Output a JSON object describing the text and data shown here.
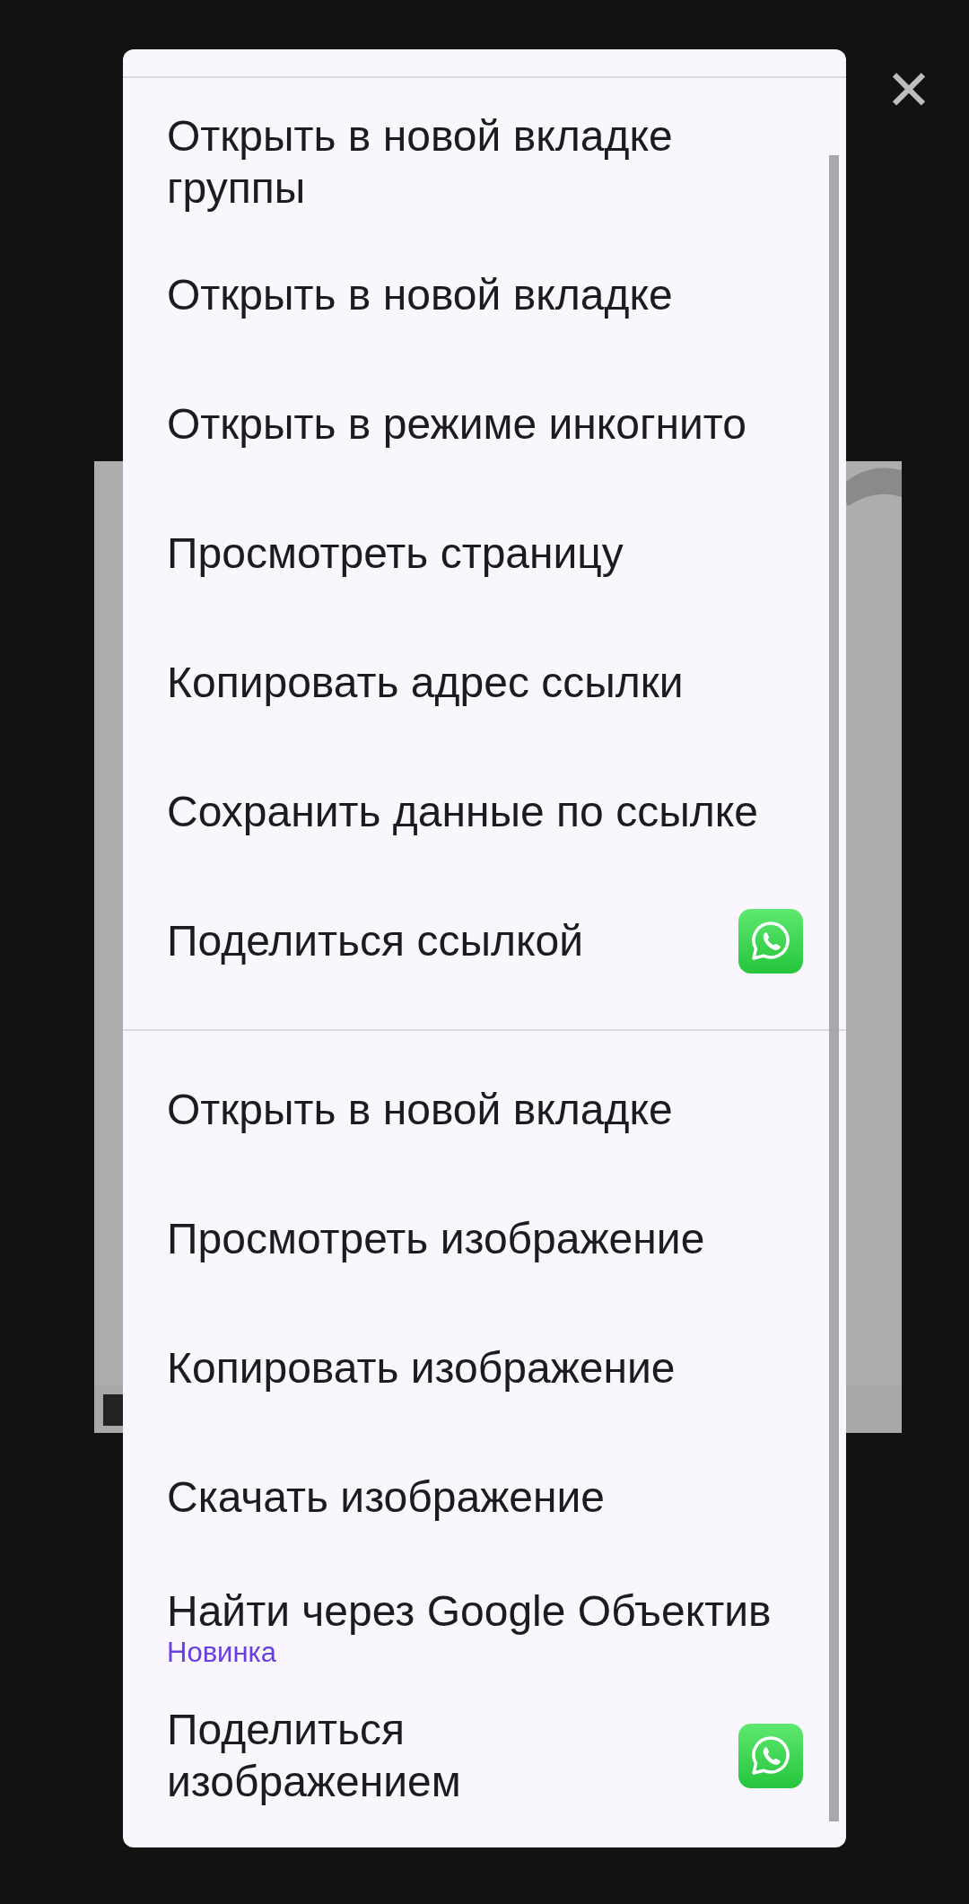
{
  "close_label": "✕",
  "menu": {
    "sections": [
      {
        "items": [
          {
            "label": "Открыть в новой вкладке группы",
            "app_icon": false
          },
          {
            "label": "Открыть в новой вкладке",
            "app_icon": false
          },
          {
            "label": "Открыть в режиме инкогнито",
            "app_icon": false
          },
          {
            "label": "Просмотреть страницу",
            "app_icon": false
          },
          {
            "label": "Копировать адрес ссылки",
            "app_icon": false
          },
          {
            "label": "Сохранить данные по ссылке",
            "app_icon": false
          },
          {
            "label": "Поделиться ссылкой",
            "app_icon": true
          }
        ]
      },
      {
        "items": [
          {
            "label": "Открыть в новой вкладке",
            "app_icon": false
          },
          {
            "label": "Просмотреть изображение",
            "app_icon": false
          },
          {
            "label": "Копировать изображение",
            "app_icon": false
          },
          {
            "label": "Скачать изображение",
            "app_icon": false
          },
          {
            "label": "Найти через Google Объектив",
            "badge": "Новинка",
            "app_icon": false
          },
          {
            "label": "Поделиться изображением",
            "app_icon": true
          }
        ]
      }
    ]
  }
}
